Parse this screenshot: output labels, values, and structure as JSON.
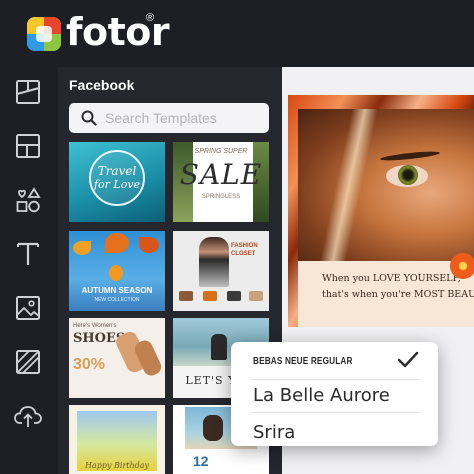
{
  "app": {
    "name": "fotor",
    "reg_mark": "®"
  },
  "panel": {
    "title": "Facebook",
    "search_placeholder": "Search Templates"
  },
  "rail": {
    "items": [
      {
        "name": "layout",
        "icon": "layout-icon"
      },
      {
        "name": "templates",
        "icon": "grid-icon"
      },
      {
        "name": "elements",
        "icon": "shapes-icon"
      },
      {
        "name": "text",
        "icon": "text-icon"
      },
      {
        "name": "photos",
        "icon": "image-icon"
      },
      {
        "name": "background",
        "icon": "background-icon"
      },
      {
        "name": "uploads",
        "icon": "cloud-upload-icon"
      }
    ]
  },
  "templates": [
    {
      "name": "travel-for-love",
      "line1": "Travel",
      "line2": "for Love"
    },
    {
      "name": "spring-sale",
      "line1": "SPRING SUPER",
      "line2": "SALE",
      "line3": "SPRINGLESS"
    },
    {
      "name": "autumn-season",
      "line1": "AUTUMN SEASON",
      "line2": "NEW COLLECTION"
    },
    {
      "name": "fashion-closet",
      "line1": "FASHION",
      "line2": "CLOSET"
    },
    {
      "name": "womens-shoes",
      "line1": "Here's Women's",
      "line2": "SHOES!",
      "line3": "30%"
    },
    {
      "name": "lets-go",
      "line1": "LET'S YOU"
    },
    {
      "name": "happy-birthday",
      "line1": "Happy Birthday"
    },
    {
      "name": "travel-12",
      "line1": "12"
    }
  ],
  "canvas": {
    "quote_line1": "When you LOVE YOURSELF,",
    "quote_line2": "that's when you're MOST BEAUTIFUL"
  },
  "font_menu": {
    "items": [
      {
        "label": "BEBAS NEUE REGULAR",
        "selected": true
      },
      {
        "label": "La Belle Aurore",
        "selected": false
      },
      {
        "label": "Srira",
        "selected": false
      }
    ]
  },
  "colors": {
    "background": "#1e1f24",
    "panel": "#26272d",
    "accent_orange": "#e8601c"
  }
}
